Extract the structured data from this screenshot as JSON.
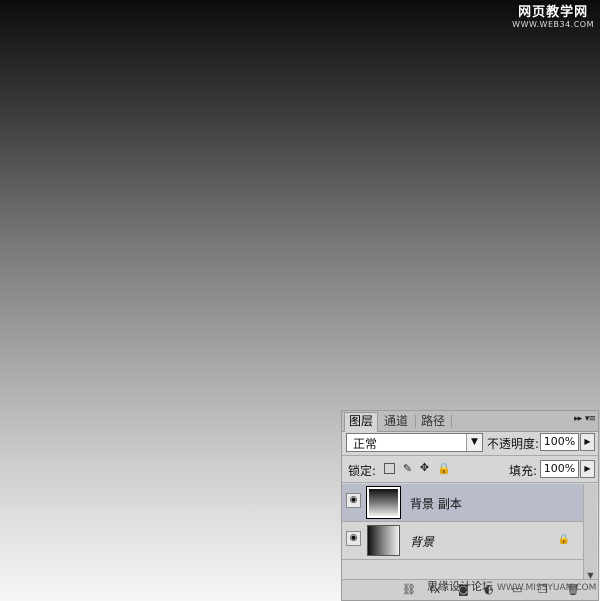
{
  "watermark_top": {
    "line1": "网页教学网",
    "line2": "WWW.WEB34.COM"
  },
  "watermark_bottom": {
    "text": "思缘设计论坛",
    "url": "WWW.MISSYUAN.COM"
  },
  "panel": {
    "tabs": [
      {
        "label": "图层",
        "active": true
      },
      {
        "label": "通道",
        "active": false
      },
      {
        "label": "路径",
        "active": false
      }
    ],
    "blend_mode": "正常",
    "opacity_label": "不透明度:",
    "opacity_value": "100%",
    "lock_label": "锁定:",
    "fill_label": "填充:",
    "fill_value": "100%",
    "layers": [
      {
        "name": "背景 副本",
        "selected": true,
        "visible": true,
        "locked": false
      },
      {
        "name": "背景",
        "selected": false,
        "visible": true,
        "locked": true
      }
    ]
  }
}
